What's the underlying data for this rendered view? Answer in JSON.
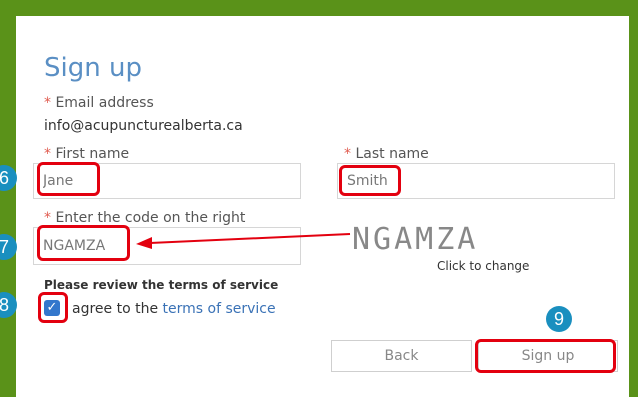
{
  "form": {
    "title": "Sign up",
    "required_mark": "*",
    "email": {
      "label": "Email address",
      "value": "info@acupuncturealberta.ca"
    },
    "first_name": {
      "label": "First name",
      "value": "Jane"
    },
    "last_name": {
      "label": "Last name",
      "value": "Smith"
    },
    "code": {
      "label": "Enter the code on the right",
      "value": "NGAMZA"
    },
    "captcha": {
      "text": "NGAMZA",
      "hint": "Click to change"
    },
    "terms": {
      "title": "Please review the terms of service",
      "agree_prefix": "agree to the",
      "link_text": "terms of service",
      "checked": true
    },
    "buttons": {
      "back": "Back",
      "sign_up": "Sign up"
    }
  },
  "annotations": {
    "step_6": "6",
    "step_7": "7",
    "step_8": "8",
    "step_9": "9",
    "highlight_color": "#e3000f",
    "badge_color": "#1a8fbf"
  },
  "colors": {
    "frame": "#5a9219",
    "title": "#5a8fc4",
    "required": "#e05a4e",
    "link": "#3a72b6",
    "checkbox": "#3377cc"
  }
}
